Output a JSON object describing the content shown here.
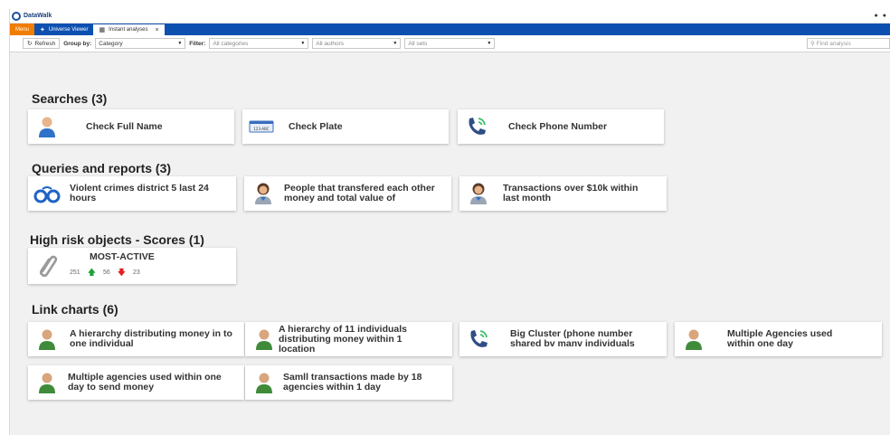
{
  "titlebar": {
    "app_name": "DataWalk"
  },
  "tabs": {
    "menu": "Menu",
    "items": [
      {
        "label": "Universe Viewer",
        "icon": "network-icon"
      },
      {
        "label": "Instant analyses",
        "icon": "grid-icon"
      }
    ]
  },
  "toolbar": {
    "refresh": "Refresh",
    "group_by_label": "Group by:",
    "group_by_value": "Category",
    "filter_label": "Filter:",
    "filter_categories": "All categories",
    "filter_authors": "All authors",
    "filter_sets": "All sets",
    "search_placeholder": "Find analysis"
  },
  "sections": {
    "searches": {
      "title": "Searches (3)",
      "items": [
        "Check Full Name",
        "Check Plate",
        "Check Phone Number"
      ]
    },
    "queries": {
      "title": "Queries and reports (3)",
      "items": [
        "Violent crimes district 5 last 24 hours",
        "People that transfered each other money and total value of",
        "Transactions over $10k within last month"
      ]
    },
    "scores": {
      "title": "High risk objects - Scores (1)",
      "item": {
        "name": "MOST-ACTIVE",
        "total": "251",
        "up": "56",
        "down": "23"
      }
    },
    "linkcharts": {
      "title": "Link charts (6)",
      "items": [
        "A hierarchy distributing money in to one individual",
        "A hierarchy of 11 individuals distributing money within 1 location",
        "Big Cluster (phone number shared bv manv individuals",
        "Multiple Agencies used within one day",
        "Multiple agencies used within one day to send money",
        "Samll transactions made by 18 agencies within 1 day"
      ]
    }
  },
  "colors": {
    "tabbar": "#0d50b0",
    "menu": "#f07c00",
    "accent_up": "#1ea33a",
    "accent_down": "#e02020"
  }
}
